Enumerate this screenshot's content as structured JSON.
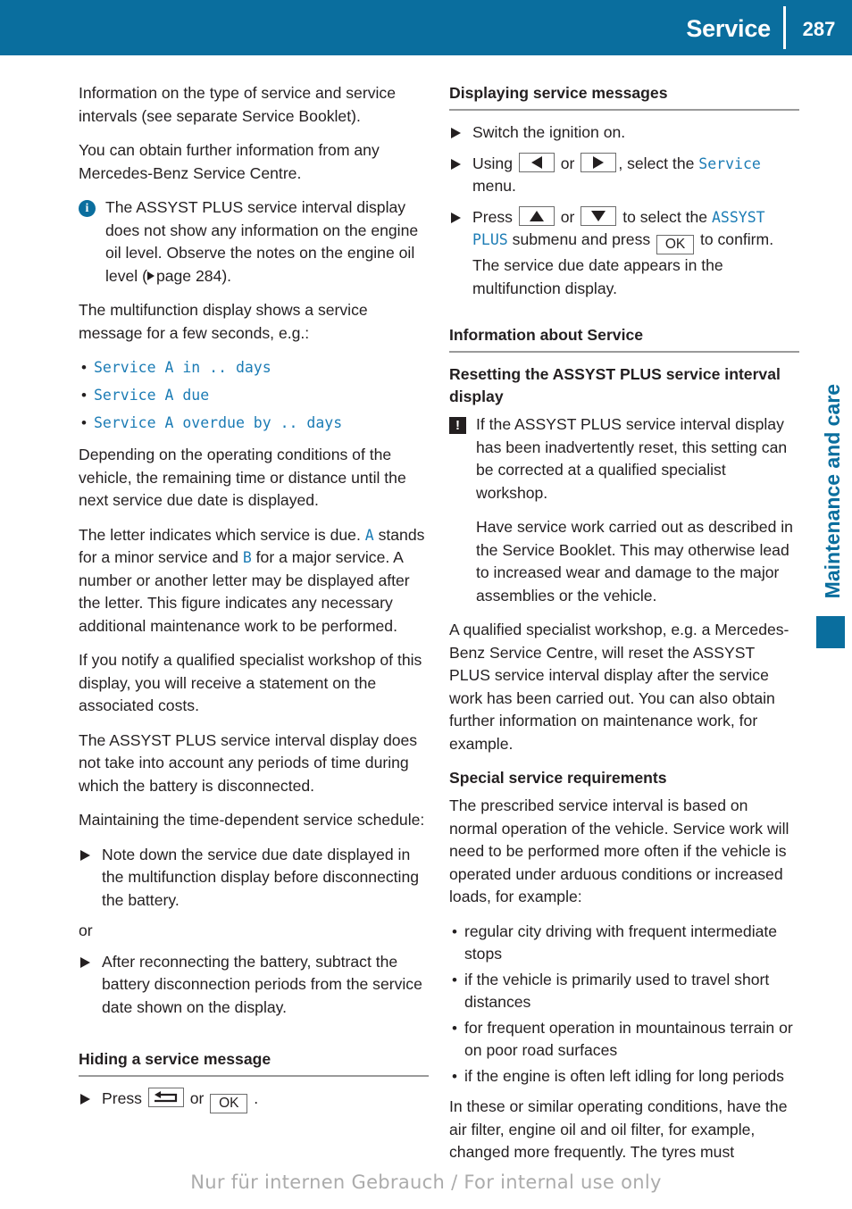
{
  "header": {
    "section_title": "Service",
    "page_number": "287",
    "bar_color": "#0a6e9e"
  },
  "side_tab": {
    "label": "Maintenance and care",
    "color": "#0a6e9e"
  },
  "accent_blue": "#1c7cb5",
  "left_column": {
    "para_1": "Information on the type of service and service intervals (see separate Service Booklet).",
    "para_2": "You can obtain further information from any Mercedes-Benz Service Centre.",
    "info_note": {
      "icon": "info-icon",
      "text_before_ref": "The ASSYST PLUS service interval display does not show any information on the engine oil level. Observe the notes on the engine oil level (",
      "page_ref": "page 284",
      "text_after_ref": ")."
    },
    "para_3": "The multifunction display shows a service message for a few seconds, e.g.:",
    "message_examples": [
      "Service A in .. days",
      "Service A due",
      "Service A overdue by .. days"
    ],
    "para_4": "Depending on the operating conditions of the vehicle, the remaining time or distance until the next service due date is displayed.",
    "letter_para": {
      "part_1": "The letter indicates which service is due. ",
      "code_a": "A",
      "part_2": " stands for a minor service and ",
      "code_b": "B",
      "part_3": " for a major service. A number or another letter may be displayed after the letter. This figure indicates any necessary additional maintenance work to be performed."
    },
    "para_5": "If you notify a qualified specialist workshop of this display, you will receive a statement on the associated costs.",
    "para_6": "The ASSYST PLUS service interval display does not take into account any periods of time during which the battery is disconnected.",
    "para_7": "Maintaining the time-dependent service schedule:",
    "step_1": "Note down the service due date displayed in the multifunction display before disconnecting the battery.",
    "or_label": "or",
    "step_2": "After reconnecting the battery, subtract the battery disconnection periods from the service date shown on the display.",
    "hiding_heading": "Hiding a service message",
    "hiding_step": {
      "press_label": "Press",
      "key_back": "back-key",
      "or_label": "or",
      "key_ok": "OK",
      "period": "."
    }
  },
  "right_column": {
    "displaying_heading": "Displaying service messages",
    "step_1": "Switch the ignition on.",
    "step_2": {
      "part_1": "Using",
      "key_left": "left-arrow-key",
      "or_label": "or",
      "key_right": "right-arrow-key",
      "part_2": ", select the",
      "code_service": "Service",
      "part_3": "menu."
    },
    "step_3": {
      "part_1": "Press",
      "key_up": "up-arrow-key",
      "or_label": "or",
      "key_down": "down-arrow-key",
      "part_2": "to select the",
      "code_assyst": "ASSYST PLUS",
      "part_3": "submenu and press",
      "key_ok": "OK",
      "part_4": "to confirm. The service due date appears in the multifunction display."
    },
    "info_heading": "Information about Service",
    "resetting_subhead": "Resetting the ASSYST PLUS service interval display",
    "warning_note": {
      "icon": "warning-icon",
      "para_1": "If the ASSYST PLUS service interval display has been inadvertently reset, this setting can be corrected at a qualified specialist workshop.",
      "para_2": "Have service work carried out as described in the Service Booklet. This may otherwise lead to increased wear and damage to the major assemblies or the vehicle."
    },
    "para_1": "A qualified specialist workshop, e.g. a Mercedes-Benz Service Centre, will reset the ASSYST PLUS service interval display after the service work has been carried out. You can also obtain further information on maintenance work, for example.",
    "special_subhead": "Special service requirements",
    "para_2": "The prescribed service interval is based on normal operation of the vehicle. Service work will need to be performed more often if the vehicle is operated under arduous conditions or increased loads, for example:",
    "conditions": [
      "regular city driving with frequent intermediate stops",
      "if the vehicle is primarily used to travel short distances",
      "for frequent operation in mountainous terrain or on poor road surfaces",
      "if the engine is often left idling for long periods"
    ],
    "para_3": "In these or similar operating conditions, have the air filter, engine oil and oil filter, for example, changed more frequently. The tyres must"
  },
  "footer": {
    "watermark": "Nur für internen Gebrauch / For internal use only"
  }
}
